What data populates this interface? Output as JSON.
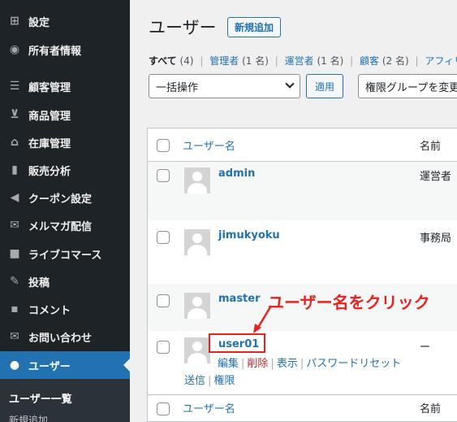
{
  "sidebar": {
    "items": [
      {
        "label": "設定",
        "icon": "settings-icon"
      },
      {
        "label": "所有者情報",
        "icon": "dashboard-icon"
      },
      {
        "label": "顧客管理",
        "icon": "list-icon"
      },
      {
        "label": "商品管理",
        "icon": "cart-icon"
      },
      {
        "label": "在庫管理",
        "icon": "store-icon"
      },
      {
        "label": "販売分析",
        "icon": "chart-icon"
      },
      {
        "label": "クーポン設定",
        "icon": "megaphone-icon"
      },
      {
        "label": "メルマガ配信",
        "icon": "mail-icon"
      },
      {
        "label": "ライブコマース",
        "icon": "video-icon"
      },
      {
        "label": "投稿",
        "icon": "pin-icon"
      },
      {
        "label": "コメント",
        "icon": "comment-icon"
      },
      {
        "label": "お問い合わせ",
        "icon": "mail-icon"
      },
      {
        "label": "ユーザー",
        "icon": "user-icon"
      }
    ],
    "submenu": {
      "current": "ユーザー一覧",
      "next": "新規追加"
    }
  },
  "header": {
    "title": "ユーザー",
    "add_new": "新規追加"
  },
  "filters": {
    "all": "すべて",
    "all_count": "(4)",
    "admin": "管理者",
    "admin_count": "(1 名)",
    "operator": "運営者",
    "operator_count": "(1 名)",
    "customer": "顧客",
    "customer_count": "(2 名)",
    "affiliate": "アフィリ"
  },
  "bulk": {
    "placeholder": "一括操作",
    "apply": "適用",
    "role_change": "権限グループを変更"
  },
  "table": {
    "col_username": "ユーザー名",
    "col_name": "名前",
    "rows": [
      {
        "username": "admin",
        "role": "運営者"
      },
      {
        "username": "jimukyoku",
        "role": "事務局"
      },
      {
        "username": "master",
        "role": ""
      },
      {
        "username": "user01",
        "role": "ー"
      }
    ],
    "row_actions": {
      "edit": "編集",
      "delete": "削除",
      "view": "表示",
      "reset_password": "パスワードリセット",
      "send": "送信",
      "permissions": "権限"
    }
  },
  "annotation": {
    "text": "ユーザー名をクリック",
    "color": "#e8231f"
  },
  "colors": {
    "sidebar": "#1d2327",
    "active": "#2271b1",
    "link": "#2271b1",
    "delete": "#b32d2e"
  }
}
